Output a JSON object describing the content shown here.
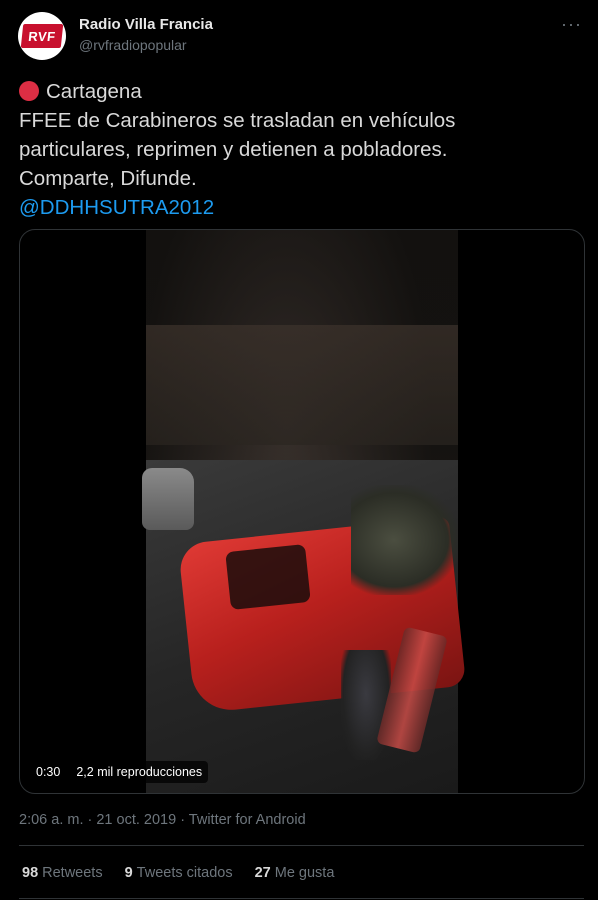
{
  "account": {
    "avatar_text": "RVF",
    "name": "Radio Villa Francia",
    "handle": "@rvfradiopopular"
  },
  "tweet": {
    "line1": "Cartagena",
    "line2": "FFEE de Carabineros se trasladan en vehículos",
    "line3": "particulares, reprimen y detienen a pobladores.",
    "line4": "Comparte, Difunde.",
    "mention": "@DDHHSUTRA2012"
  },
  "video": {
    "duration": "0:30",
    "views": "2,2 mil reproducciones"
  },
  "meta": {
    "timestamp": "2:06 a. m. · 21 oct. 2019 · Twitter for Android"
  },
  "stats": {
    "retweets_count": "98",
    "retweets_label": "Retweets",
    "quotes_count": "9",
    "quotes_label": "Tweets citados",
    "likes_count": "27",
    "likes_label": "Me gusta"
  },
  "colors": {
    "background": "#000000",
    "mention": "#1d9bf0",
    "secondary_text": "#6e767d",
    "red_dot": "#dd2e44",
    "brand_red": "#c8102e"
  },
  "icons": {
    "more": "more-icon",
    "red_circle": "red-circle-icon"
  }
}
